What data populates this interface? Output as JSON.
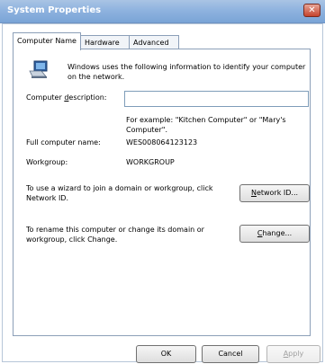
{
  "window": {
    "title": "System Properties",
    "close_glyph": "✕"
  },
  "tabs": [
    {
      "label": "Computer Name"
    },
    {
      "label": "Hardware"
    },
    {
      "label": "Advanced"
    }
  ],
  "intro": "Windows uses the following information to identify your computer on the network.",
  "description": {
    "label_pre": "Computer ",
    "label_key": "d",
    "label_post": "escription:",
    "value": ""
  },
  "example": "For example: \"Kitchen Computer\" or \"Mary's Computer\".",
  "full_name": {
    "label": "Full computer name:",
    "value": "WES008064123123"
  },
  "workgroup": {
    "label": "Workgroup:",
    "value": "WORKGROUP"
  },
  "network_id": {
    "text": "To use a wizard to join a domain or workgroup, click Network ID.",
    "button_key": "N",
    "button_rest": "etwork ID..."
  },
  "change": {
    "text": "To rename this computer or change its domain or workgroup, click Change.",
    "button_key": "C",
    "button_rest": "hange..."
  },
  "footer": {
    "ok": "OK",
    "cancel": "Cancel",
    "apply_key": "A",
    "apply_rest": "pply"
  },
  "icons": {
    "titlebar_close": "close-icon",
    "computer": "computer-icon"
  }
}
